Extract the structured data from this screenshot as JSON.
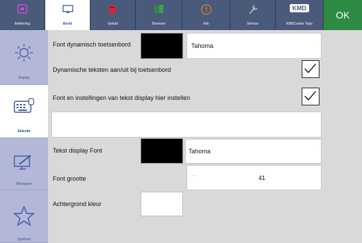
{
  "toolbar": {
    "tabs": [
      {
        "label": "Bediening",
        "icon": "hand-icon"
      },
      {
        "label": "Beeld",
        "icon": "monitor-icon"
      },
      {
        "label": "Geluid",
        "icon": "speaker-icon"
      },
      {
        "label": "Diversen",
        "icon": "diversen-icon"
      },
      {
        "label": "Info",
        "icon": "info-icon"
      },
      {
        "label": "Service",
        "icon": "wrench-icon"
      },
      {
        "label": "KMDCreate Togo",
        "icon": "kmd-logo"
      }
    ],
    "active_tab": "Beeld",
    "logo_text": "KMD",
    "ok_label": "OK"
  },
  "sidebar": {
    "items": [
      {
        "label": "Display",
        "icon": "sun-icon"
      },
      {
        "label": "Selectie",
        "icon": "keyboard-icon"
      },
      {
        "label": "Weergave",
        "icon": "monitor-pen-icon"
      },
      {
        "label": "Symbool",
        "icon": "star-icon"
      }
    ],
    "active_item": "Selectie"
  },
  "main": {
    "font_keyboard_label": "Font dynamisch toetsenbord",
    "font_keyboard_value": "Tahoma",
    "dynamic_texts_label": "Dynamische teksten aan/uit bij toetsenbord",
    "font_display_settings_label": "Font en instellingen van tekst display hier instellen",
    "text_display_font_label": "Tekst display Font",
    "text_display_font_value": "Tahoma",
    "font_size_label": "Font grootte",
    "font_size_value": "41",
    "background_color_label": "Achtergrond kleur"
  },
  "colors": {
    "topbar": "#4a5a7a",
    "ok": "#2e8b43",
    "sidebar": "#b4b8d8",
    "background": "#d9d9d9"
  }
}
